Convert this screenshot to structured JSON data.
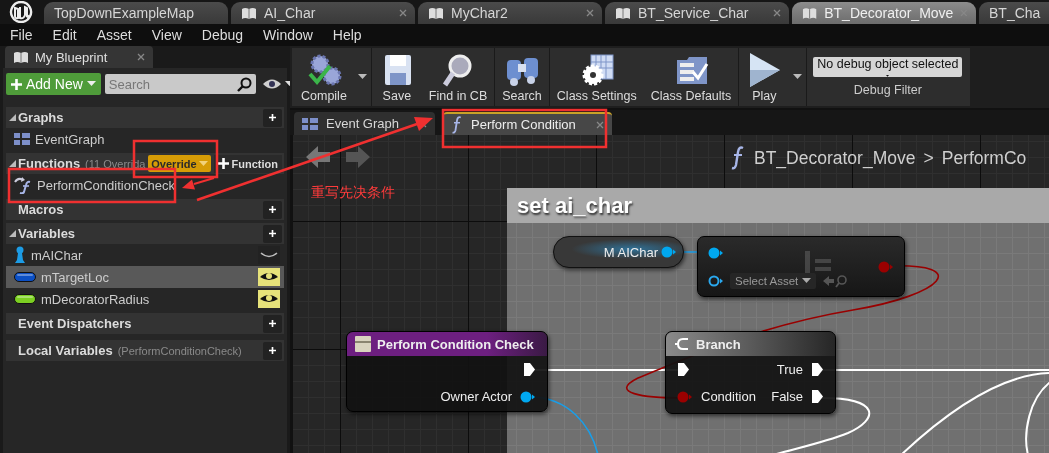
{
  "editor_tabs": [
    {
      "label": "TopDownExampleMap",
      "kind": "level",
      "selected": false,
      "closable": false
    },
    {
      "label": "AI_Char",
      "kind": "blueprint",
      "selected": false,
      "closable": true
    },
    {
      "label": "MyChar2",
      "kind": "blueprint",
      "selected": false,
      "closable": true
    },
    {
      "label": "BT_Service_Char",
      "kind": "blueprint",
      "selected": false,
      "closable": true
    },
    {
      "label": "BT_Decorator_Move",
      "kind": "blueprint",
      "selected": true,
      "closable": true
    },
    {
      "label": "BT_Cha",
      "kind": "level",
      "selected": false,
      "closable": false
    }
  ],
  "menu": [
    "File",
    "Edit",
    "Asset",
    "View",
    "Debug",
    "Window",
    "Help"
  ],
  "my_blueprint": {
    "title": "My Blueprint",
    "add_new": "Add New",
    "search": {
      "placeholder": "Search"
    },
    "sections": [
      {
        "title": "Graphs",
        "expanded": true,
        "items": [
          {
            "label": "EventGraph",
            "kind": "graph"
          }
        ]
      },
      {
        "title": "Functions",
        "note": "(11 Overrida",
        "expanded": true,
        "override": "Override",
        "add_label": "Function",
        "items": [
          {
            "label": "PerformConditionCheck",
            "kind": "function"
          }
        ]
      },
      {
        "title": "Macros"
      },
      {
        "title": "Variables",
        "expanded": true,
        "items": [
          {
            "label": "mAIChar",
            "kind": "object",
            "color": "#1c9ce6",
            "public": false,
            "selected": false
          },
          {
            "label": "mTargetLoc",
            "kind": "struct",
            "color": "#0b4fc4",
            "public": true,
            "selected": true
          },
          {
            "label": "mDecoratorRadius",
            "kind": "float",
            "color": "#7ccf22",
            "public": true,
            "selected": false
          }
        ]
      },
      {
        "title": "Event Dispatchers"
      },
      {
        "title": "Local Variables",
        "note": "(PerformConditionCheck)"
      }
    ]
  },
  "toolbar": {
    "buttons": [
      {
        "label": "Compile",
        "kind": "compile",
        "dropdown": true
      },
      {
        "label": "Save",
        "kind": "save",
        "dropdown": false
      },
      {
        "label": "Find in CB",
        "kind": "find",
        "dropdown": false
      },
      {
        "label": "Search",
        "kind": "search",
        "dropdown": false
      },
      {
        "label": "Class Settings",
        "kind": "settings",
        "dropdown": false
      },
      {
        "label": "Class Defaults",
        "kind": "defaults",
        "dropdown": false
      },
      {
        "label": "Play",
        "kind": "play",
        "dropdown": true
      }
    ],
    "debug_filter": {
      "value": "No debug object selected",
      "label": "Debug Filter"
    }
  },
  "document_tabs": [
    {
      "label": "Event Graph",
      "kind": "graph",
      "selected": false
    },
    {
      "label": "Perform Condition",
      "kind": "function",
      "selected": true
    }
  ],
  "graph": {
    "breadcrumb": {
      "blueprint": "BT_Decorator_Move",
      "separator": ">",
      "function": "PerformCo"
    },
    "comment": "set ai_char",
    "nodes": [
      {
        "kind": "variable",
        "title": "M AIChar",
        "outputs": [
          {
            "kind": "object"
          }
        ]
      },
      {
        "kind": "cast",
        "inputs": [
          {
            "kind": "object"
          },
          {
            "kind": "class",
            "dropdown": "Select Asset"
          }
        ],
        "outputs": [
          {
            "kind": "bool"
          }
        ]
      },
      {
        "kind": "event",
        "title": "Perform Condition Check",
        "outputs": [
          {
            "kind": "exec"
          },
          {
            "kind": "object",
            "label": "Owner Actor"
          }
        ]
      },
      {
        "kind": "branch",
        "title": "Branch",
        "inputs": [
          {
            "kind": "exec"
          },
          {
            "kind": "bool",
            "label": "Condition"
          }
        ],
        "outputs": [
          {
            "kind": "exec",
            "label": "True"
          },
          {
            "kind": "exec",
            "label": "False"
          }
        ]
      }
    ]
  },
  "annotation": {
    "label": "重写先决条件"
  }
}
